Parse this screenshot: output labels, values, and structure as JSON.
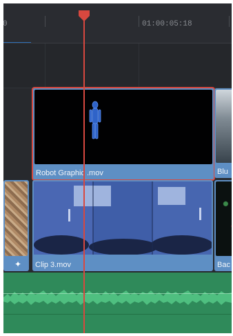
{
  "ruler": {
    "timecode": "01:00:05:18",
    "left_edge_digit": "0"
  },
  "clips": {
    "upper": [
      {
        "label": "Robot Graphic .mov",
        "selected": true
      },
      {
        "label": "Blu"
      }
    ],
    "lower": [
      {
        "label": ""
      },
      {
        "label": "Clip 3.mov"
      },
      {
        "label": "Bac"
      }
    ]
  },
  "icons": {
    "playhead": "playhead-marker-icon",
    "effect": "sparkle-icon"
  },
  "colors": {
    "clip": "#5e8fc4",
    "selection": "#d8483f",
    "playhead": "#d8483f",
    "audio": "#2f8a5a"
  }
}
